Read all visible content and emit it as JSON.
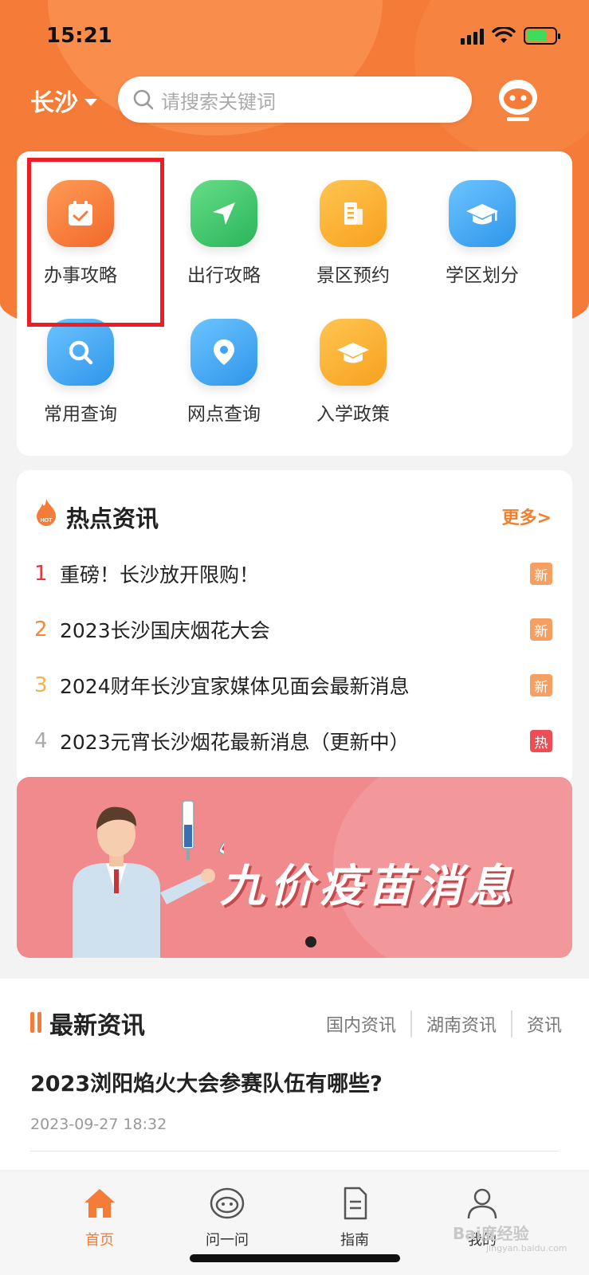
{
  "status_bar": {
    "time": "15:21"
  },
  "header": {
    "city": "长沙",
    "search_placeholder": "请搜索关键词"
  },
  "services": [
    {
      "label": "办事攻略",
      "icon": "calendar-check-icon",
      "color": "#f57c38"
    },
    {
      "label": "出行攻略",
      "icon": "navigation-arrow-icon",
      "color": "#35c064"
    },
    {
      "label": "景区预约",
      "icon": "document-icon",
      "color": "#f9aa2c"
    },
    {
      "label": "学区划分",
      "icon": "graduation-cap-icon",
      "color": "#3ea3f0"
    },
    {
      "label": "常用查询",
      "icon": "search-icon",
      "color": "#3ea3f0"
    },
    {
      "label": "网点查询",
      "icon": "location-pin-icon",
      "color": "#3ea3f0"
    },
    {
      "label": "入学政策",
      "icon": "graduation-cap-icon",
      "color": "#f9aa2c"
    }
  ],
  "hot_news": {
    "title": "热点资讯",
    "more": "更多>",
    "items": [
      {
        "rank": "1",
        "text": "重磅！长沙放开限购！",
        "badge": "新"
      },
      {
        "rank": "2",
        "text": "2023长沙国庆烟花大会",
        "badge": "新"
      },
      {
        "rank": "3",
        "text": "2024财年长沙宜家媒体见面会最新消息",
        "badge": "新"
      },
      {
        "rank": "4",
        "text": "2023元宵长沙烟花最新消息（更新中）",
        "badge": "热"
      }
    ]
  },
  "banner": {
    "title": "九价疫苗消息"
  },
  "latest": {
    "title": "最新资讯",
    "tabs": [
      "国内资讯",
      "湖南资讯",
      "资讯"
    ],
    "article": {
      "title": "2023浏阳焰火大会参赛队伍有哪些?",
      "time": "2023-09-27 18:32"
    }
  },
  "tabbar": [
    {
      "label": "首页",
      "icon": "home-icon"
    },
    {
      "label": "问一问",
      "icon": "robot-icon"
    },
    {
      "label": "指南",
      "icon": "document-icon"
    },
    {
      "label": "我的",
      "icon": "user-icon"
    }
  ],
  "watermark": {
    "text": "Bai度经验",
    "sub": "jingyan.baidu.com"
  }
}
